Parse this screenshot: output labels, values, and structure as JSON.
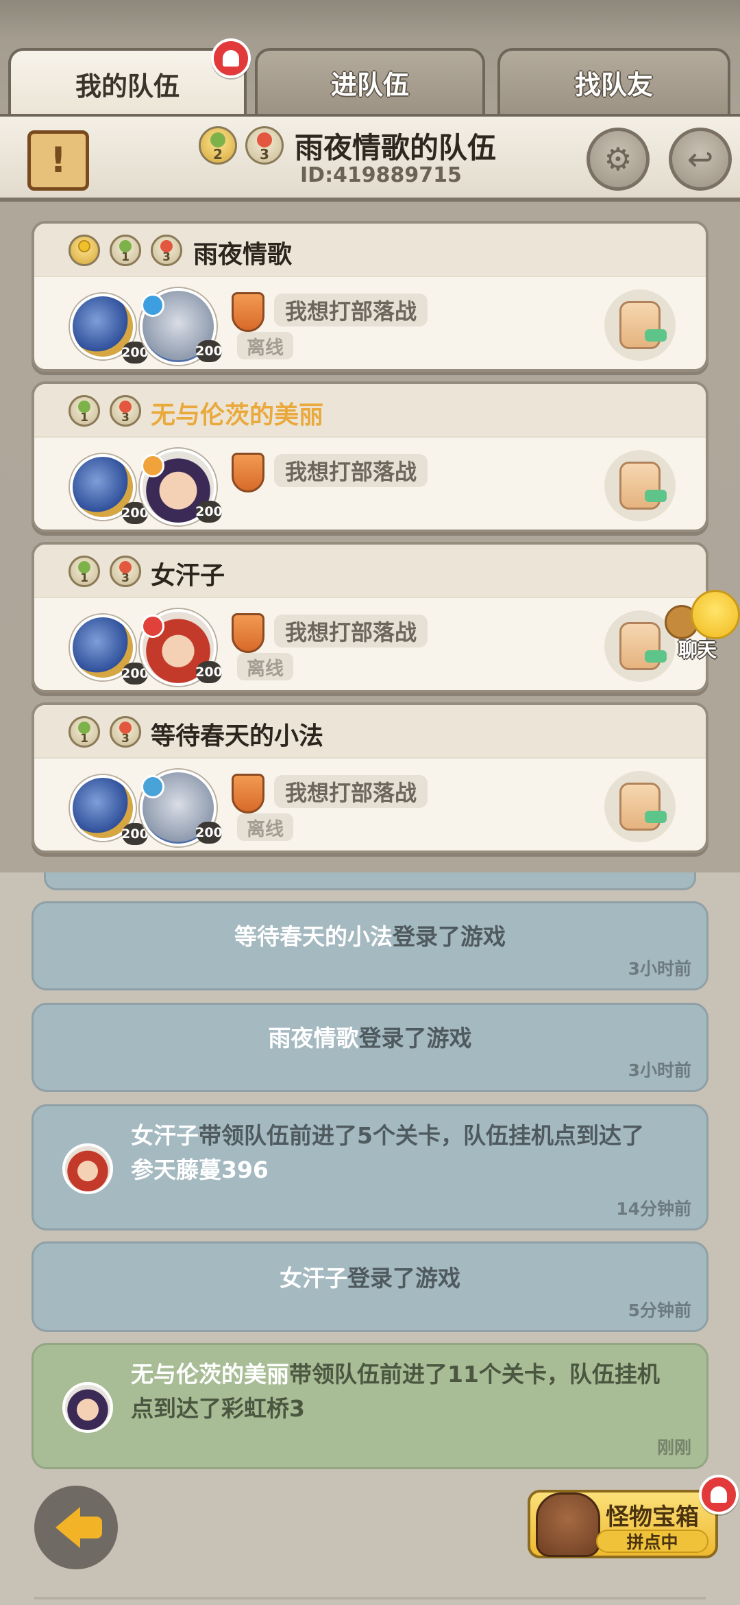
{
  "tabs": [
    {
      "label": "我的队伍",
      "active": true
    },
    {
      "label": "进队伍",
      "active": false
    },
    {
      "label": "找队友",
      "active": false
    }
  ],
  "header": {
    "scroll_glyph": "!",
    "badge1": "2",
    "badge2": "3",
    "title": "雨夜情歌的队伍",
    "id": "ID:419889715"
  },
  "members": [
    {
      "name": "雨夜情歌",
      "leader": true,
      "badge_levels": [
        "1",
        "3"
      ],
      "lvl1": "200",
      "lvl2": "200",
      "want": "我想打部落战",
      "status": "离线",
      "show_status": true
    },
    {
      "name": "无与伦茨的美丽",
      "leader": false,
      "badge_levels": [
        "1",
        "3"
      ],
      "lvl1": "200",
      "lvl2": "200",
      "want": "我想打部落战",
      "status": "",
      "show_status": false
    },
    {
      "name": "女汗子",
      "leader": false,
      "badge_levels": [
        "1",
        "3"
      ],
      "lvl1": "200",
      "lvl2": "200",
      "want": "我想打部落战",
      "status": "离线",
      "show_status": true
    },
    {
      "name": "等待春天的小法",
      "leader": false,
      "badge_levels": [
        "1",
        "3"
      ],
      "lvl1": "200",
      "lvl2": "200",
      "want": "我想打部落战",
      "status": "离线",
      "show_status": true
    }
  ],
  "chat": {
    "label": "聊天"
  },
  "logs": [
    {
      "name": "等待春天的小法",
      "text": "登录了游戏",
      "time": "3小时前"
    },
    {
      "name": "雨夜情歌",
      "text": "登录了游戏",
      "time": "3小时前"
    },
    {
      "name": "女汗子",
      "text_line1": "带领队伍前进了5个关卡，队伍挂机点到达了",
      "text_line2": "参天藤蔓396",
      "time": "14分钟前"
    },
    {
      "name": "女汗子",
      "text": "登录了游戏",
      "time": "5分钟前"
    },
    {
      "name": "无与伦茨的美丽",
      "text_line1": "带领队伍前进了11个关卡，队伍挂机",
      "text_line2": "点到达了彩虹桥3",
      "time": "刚刚"
    }
  ],
  "treasure": {
    "title": "怪物宝箱",
    "status": "拼点中"
  },
  "colors": {
    "log_blue": "#a5b9c1",
    "log_green": "#a8bd96",
    "accent_gold": "#e9a93c",
    "bell_red": "#e23a3a"
  }
}
